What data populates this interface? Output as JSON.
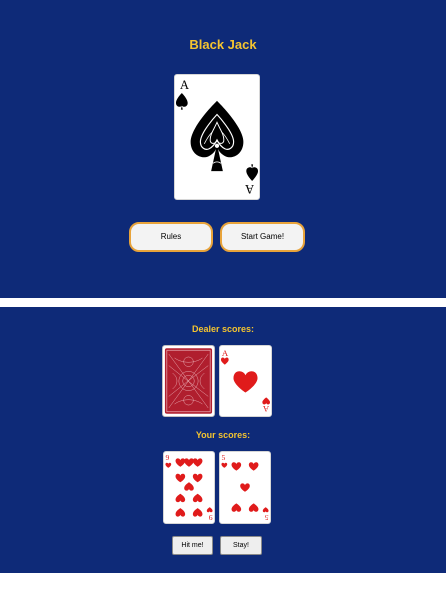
{
  "intro": {
    "title": "Black Jack",
    "hero_card": {
      "rank": "A",
      "suit": "spades"
    },
    "buttons": {
      "rules": "Rules",
      "start": "Start Game!"
    }
  },
  "game": {
    "dealer_label": "Dealer scores:",
    "player_label": "Your scores:",
    "dealer_cards": [
      {
        "face": "back"
      },
      {
        "rank": "A",
        "suit": "hearts"
      }
    ],
    "player_cards": [
      {
        "rank": "9",
        "suit": "hearts"
      },
      {
        "rank": "5",
        "suit": "hearts"
      }
    ],
    "buttons": {
      "hit": "Hit me!",
      "stay": "Stay!"
    }
  },
  "colors": {
    "panel_bg": "#0e2a78",
    "title_gold": "#f4c430",
    "button_border": "#e8a33a",
    "card_back": "#b01e2e",
    "heart_red": "#e01b1b"
  }
}
